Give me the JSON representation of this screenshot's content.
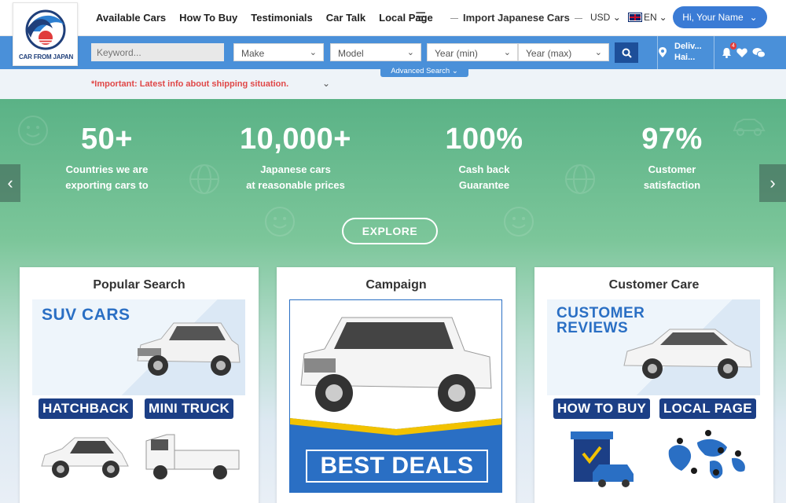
{
  "logo": {
    "text": "CAR FROM JAPAN"
  },
  "nav": {
    "items": [
      "Available Cars",
      "How To Buy",
      "Testimonials",
      "Car Talk",
      "Local Page"
    ],
    "import_label": "Import Japanese Cars",
    "currency": "USD",
    "language": "EN",
    "user_label": "Hi, Your Name"
  },
  "search": {
    "keyword_placeholder": "Keyword...",
    "make": "Make",
    "model": "Model",
    "year_min": "Year (min)",
    "year_max": "Year (max)",
    "advanced_label": "Advanced Search",
    "deliver_line1": "Deliv...",
    "deliver_line2": "Hai...",
    "notification_count": "4"
  },
  "notice": {
    "text": "*Important: Latest info about shipping situation."
  },
  "hero": {
    "stats": [
      {
        "number": "50+",
        "line1": "Countries we are",
        "line2": "exporting cars to"
      },
      {
        "number": "10,000+",
        "line1": "Japanese cars",
        "line2": "at reasonable prices"
      },
      {
        "number": "100%",
        "line1": "Cash back",
        "line2": "Guarantee"
      },
      {
        "number": "97%",
        "line1": "Customer",
        "line2": "satisfaction"
      }
    ],
    "explore_label": "EXPLORE"
  },
  "cards": {
    "popular": {
      "title": "Popular Search",
      "suv": "SUV CARS",
      "hatchback": "HATCHBACK",
      "mini_truck": "MINI TRUCK"
    },
    "campaign": {
      "title": "Campaign",
      "best_deals": "BEST DEALS"
    },
    "customer": {
      "title": "Customer Care",
      "reviews_line1": "CUSTOMER",
      "reviews_line2": "REVIEWS",
      "how_to_buy": "HOW TO BUY",
      "local_page": "LOCAL PAGE"
    }
  },
  "colors": {
    "primary": "#4a90d9",
    "dark_blue": "#1c3f86",
    "hero_green": "#5ab286",
    "notice_red": "#e04848"
  }
}
